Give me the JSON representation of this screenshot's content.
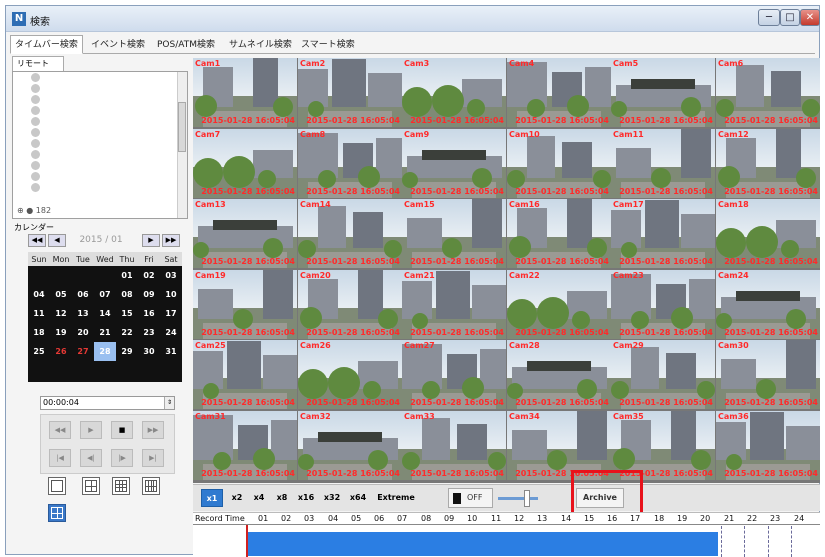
{
  "window": {
    "title": "検索",
    "min_glyph": "─",
    "max_glyph": "□",
    "close_glyph": "✕",
    "icon_glyph": "N"
  },
  "tabs": [
    "タイムバー検索",
    "イベント検索",
    "POS/ATM検索",
    "サムネイル検索",
    "スマート検索"
  ],
  "active_tab": 0,
  "left": {
    "subtab": "リモート",
    "tree_last_item": "182",
    "calendar_label": "カレンダー",
    "calendar_nav": {
      "prev_year": "◀◀",
      "prev_month": "◀",
      "next_month": "▶",
      "next_year": "▶▶"
    },
    "calendar_month": "2015 / 01",
    "weekdays": [
      "Sun",
      "Mon",
      "Tue",
      "Wed",
      "Thu",
      "Fri",
      "Sat"
    ],
    "weeks": [
      [
        "",
        "",
        "",
        "",
        "01",
        "02",
        "03"
      ],
      [
        "04",
        "05",
        "06",
        "07",
        "08",
        "09",
        "10"
      ],
      [
        "11",
        "12",
        "13",
        "14",
        "15",
        "16",
        "17"
      ],
      [
        "18",
        "19",
        "20",
        "21",
        "22",
        "23",
        "24"
      ],
      [
        "25",
        "26",
        "27",
        "28",
        "29",
        "30",
        "31"
      ]
    ],
    "red_days": [
      "26",
      "27"
    ],
    "selected_day": "28",
    "time_value": "00:00:04",
    "spin_glyph": "⇕",
    "playback": {
      "rew": "◀◀",
      "play_rev": "▶",
      "stop": "■",
      "fwd": "▶▶",
      "first": "|◀",
      "step_back": "◀|",
      "step_fwd": "|▶",
      "last": "▶|"
    }
  },
  "cameras": [
    {
      "name": "Cam1",
      "time": "2015-01-28 16:05:04"
    },
    {
      "name": "Cam2",
      "time": "2015-01-28 16:05:04"
    },
    {
      "name": "Cam3",
      "time": "2015-01-28 16:05:04"
    },
    {
      "name": "Cam4",
      "time": "2015-01-28 16:05:04"
    },
    {
      "name": "Cam5",
      "time": "2015-01-28 16:05:04"
    },
    {
      "name": "Cam6",
      "time": "2015-01-28 16:05:04"
    },
    {
      "name": "Cam7",
      "time": "2015-01-28 16:05:04"
    },
    {
      "name": "Cam8",
      "time": "2015-01-28 16:05:04"
    },
    {
      "name": "Cam9",
      "time": "2015-01-28 16:05:04"
    },
    {
      "name": "Cam10",
      "time": "2015-01-28 16:05:04"
    },
    {
      "name": "Cam11",
      "time": "2015-01-28 16:05:04"
    },
    {
      "name": "Cam12",
      "time": "2015-01-28 16:05:04"
    },
    {
      "name": "Cam13",
      "time": "2015-01-28 16:05:04"
    },
    {
      "name": "Cam14",
      "time": "2015-01-28 16:05:04"
    },
    {
      "name": "Cam15",
      "time": "2015-01-28 16:05:04"
    },
    {
      "name": "Cam16",
      "time": "2015-01-28 16:05:04"
    },
    {
      "name": "Cam17",
      "time": "2015-01-28 16:05:04"
    },
    {
      "name": "Cam18",
      "time": "2015-01-28 16:05:04"
    },
    {
      "name": "Cam19",
      "time": "2015-01-28 16:05:04"
    },
    {
      "name": "Cam20",
      "time": "2015-01-28 16:05:04"
    },
    {
      "name": "Cam21",
      "time": "2015-01-28 16:05:04"
    },
    {
      "name": "Cam22",
      "time": "2015-01-28 16:05:04"
    },
    {
      "name": "Cam23",
      "time": "2015-01-28 16:05:04"
    },
    {
      "name": "Cam24",
      "time": "2015-01-28 16:05:04"
    },
    {
      "name": "Cam25",
      "time": "2015-01-28 16:05:04"
    },
    {
      "name": "Cam26",
      "time": "2015-01-28 16:05:04"
    },
    {
      "name": "Cam27",
      "time": "2015-01-28 16:05:04"
    },
    {
      "name": "Cam28",
      "time": "2015-01-28 16:05:04"
    },
    {
      "name": "Cam29",
      "time": "2015-01-28 16:05:04"
    },
    {
      "name": "Cam30",
      "time": "2015-01-28 16:05:04"
    },
    {
      "name": "Cam31",
      "time": "2015-01-28 16:05:04"
    },
    {
      "name": "Cam32",
      "time": "2015-01-28 16:05:04"
    },
    {
      "name": "Cam33",
      "time": "2015-01-28 16:05:04"
    },
    {
      "name": "Cam34",
      "time": "2015-01-28 16:05:04"
    },
    {
      "name": "Cam35",
      "time": "2015-01-28 16:05:04"
    },
    {
      "name": "Cam36",
      "time": "2015-01-28 16:05:04"
    }
  ],
  "speeds": [
    "x1",
    "x2",
    "x4",
    "x8",
    "x16",
    "x32",
    "x64",
    "Extreme"
  ],
  "active_speed": "x1",
  "audio": {
    "label": "OFF"
  },
  "archive_label": "Archive",
  "timeline": {
    "label": "Record Time",
    "hours": [
      "01",
      "02",
      "03",
      "04",
      "05",
      "06",
      "07",
      "08",
      "09",
      "10",
      "11",
      "12",
      "13",
      "14",
      "15",
      "16",
      "17",
      "18",
      "19",
      "20",
      "21",
      "22",
      "23",
      "24"
    ],
    "recorded_until_hour": 20,
    "cursor_hour": 0
  },
  "colors": {
    "accent": "#2f7ad0",
    "record_bar": "#2b7ee3",
    "highlight": "#e8121b",
    "cam_text": "#ff2a2a",
    "cursor": "#d02020"
  }
}
